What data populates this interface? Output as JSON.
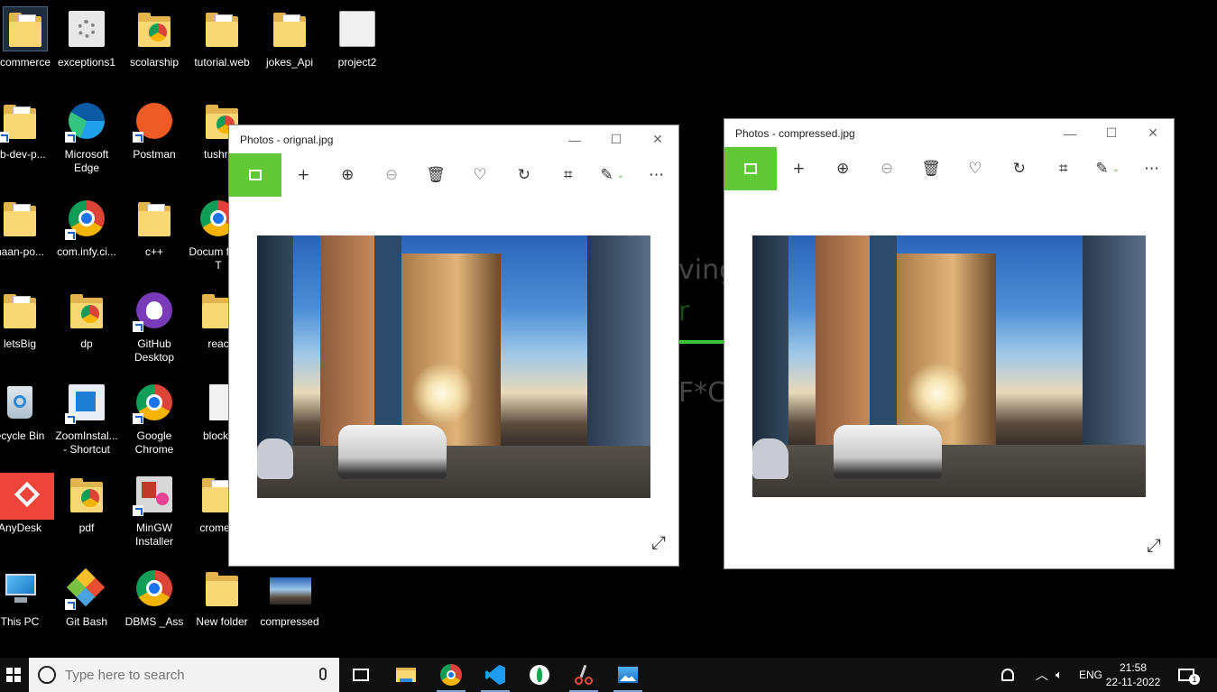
{
  "desktop": {
    "icons": [
      {
        "label": "commerce"
      },
      {
        "label": "exceptions1"
      },
      {
        "label": "scolarship"
      },
      {
        "label": "tutorial.web"
      },
      {
        "label": "jokes_Api"
      },
      {
        "label": "project2"
      },
      {
        "label": "eb-dev-p..."
      },
      {
        "label": "Microsoft Edge"
      },
      {
        "label": "Postman"
      },
      {
        "label": "tushr_p"
      },
      {
        "label": "haan-po..."
      },
      {
        "label": "com.infy.ci..."
      },
      {
        "label": "c++"
      },
      {
        "label": "Docum from T"
      },
      {
        "label": "letsBig"
      },
      {
        "label": "dp"
      },
      {
        "label": "GitHub Desktop"
      },
      {
        "label": "reac"
      },
      {
        "label": "ecycle Bin"
      },
      {
        "label": "ZoomInstal... - Shortcut"
      },
      {
        "label": "Google Chrome"
      },
      {
        "label": "blockc"
      },
      {
        "label": "AnyDesk"
      },
      {
        "label": "pdf"
      },
      {
        "label": "MinGW Installer"
      },
      {
        "label": "cromeE"
      },
      {
        "label": "This PC"
      },
      {
        "label": "Git Bash"
      },
      {
        "label": "DBMS _Ass"
      },
      {
        "label": "New folder"
      },
      {
        "label": "compressed"
      }
    ],
    "background_text": [
      "ving",
      "r",
      "F*C"
    ]
  },
  "windows": [
    {
      "title": "Photos - orignal.jpg",
      "min": "—",
      "max": "☐",
      "close": "✕"
    },
    {
      "title": "Photos - compressed.jpg",
      "min": "—",
      "max": "☐",
      "close": "✕"
    }
  ],
  "toolbar_glyphs": {
    "add": "+",
    "zoom_in": "⊕",
    "zoom_out": "⊖",
    "delete": "🗑",
    "favorite": "♡",
    "rotate": "↻",
    "crop": "⌗",
    "edit": "✎",
    "chevron": "⌄",
    "more": "⋯",
    "expand": "⤢"
  },
  "taskbar": {
    "search_placeholder": "Type here to search",
    "language": "ENG",
    "time": "21:58",
    "date": "22-11-2022",
    "notification_count": "1"
  },
  "colors": {
    "photos_accent": "#63c837",
    "taskbar_bg": "#101010",
    "desktop_bg": "#000000"
  }
}
